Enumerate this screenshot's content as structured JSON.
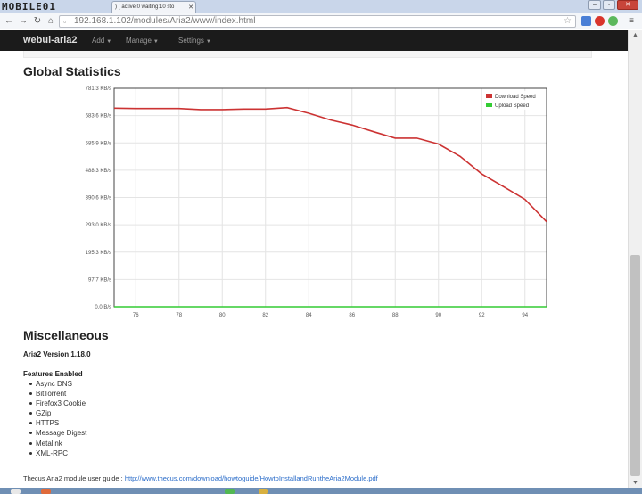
{
  "browser": {
    "logo_text": "MOBILE01",
    "tab_title": ") ( active:0 waiting:10 sto",
    "url": "192.168.1.102/modules/Aria2/www/index.html"
  },
  "navbar": {
    "brand": "webui-aria2",
    "items": [
      {
        "label": "Add"
      },
      {
        "label": "Manage"
      },
      {
        "label": "Settings"
      }
    ]
  },
  "stats": {
    "heading": "Global Statistics"
  },
  "chart_data": {
    "type": "line",
    "title": "",
    "xlabel": "",
    "ylabel": "",
    "x_ticks": [
      "76",
      "78",
      "80",
      "82",
      "84",
      "86",
      "88",
      "90",
      "92",
      "94"
    ],
    "y_ticks": [
      "0.0 B/s",
      "97.7 KB/s",
      "195.3 KB/s",
      "293.0 KB/s",
      "390.6 KB/s",
      "488.3 KB/s",
      "585.9 KB/s",
      "683.6 KB/s",
      "781.3 KB/s"
    ],
    "xlim": [
      75,
      95
    ],
    "ylim": [
      0,
      781.3
    ],
    "y_unit": "KB/s",
    "grid": true,
    "legend_position": "top-right",
    "series": [
      {
        "name": "Download Speed",
        "color": "#cc3333",
        "x": [
          75,
          76,
          77,
          78,
          79,
          80,
          81,
          82,
          83,
          84,
          85,
          86,
          87,
          88,
          89,
          90,
          91,
          92,
          93,
          94,
          95
        ],
        "values": [
          710,
          709,
          709,
          709,
          705,
          705,
          707,
          707,
          712,
          692,
          668,
          650,
          626,
          603,
          603,
          582,
          538,
          475,
          430,
          384,
          304
        ]
      },
      {
        "name": "Upload Speed",
        "color": "#33cc33",
        "x": [
          75,
          95
        ],
        "values": [
          0,
          0
        ]
      }
    ]
  },
  "misc": {
    "heading": "Miscellaneous",
    "version": "Aria2 Version 1.18.0",
    "features_title": "Features Enabled",
    "features": [
      "Async DNS",
      "BitTorrent",
      "Firefox3 Cookie",
      "GZip",
      "HTTPS",
      "Message Digest",
      "Metalink",
      "XML-RPC"
    ],
    "guide_label": "Thecus Aria2 module user guide :",
    "guide_link": "http://www.thecus.com/download/howtoguide/HowtoInstallandRuntheAria2Module.pdf"
  }
}
